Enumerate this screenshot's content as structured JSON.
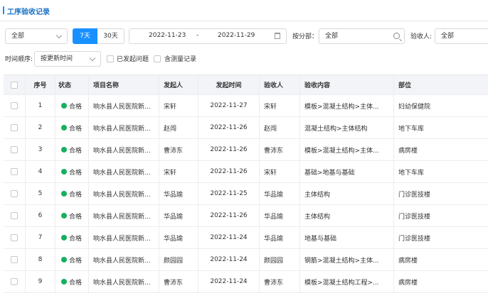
{
  "header": {
    "title": "工序验收记录"
  },
  "filters": {
    "project_select": "全部",
    "range_7d": "7天",
    "range_30d": "30天",
    "date_start": "2022-11-23",
    "date_sep": "-",
    "date_end": "2022-11-29",
    "partition_label": "按分部：",
    "partition_value": "全部",
    "acceptor_label": "验收人:",
    "acceptor_value": "全部",
    "time_order_label": "时间顺序:",
    "time_order_value": "按更新时间",
    "issue_label": "已发起问题",
    "measure_label": "含测量记录"
  },
  "table": {
    "columns": [
      "序号",
      "状态",
      "项目名称",
      "发起人",
      "发起时间",
      "验收人",
      "验收内容",
      "部位"
    ],
    "rows": [
      {
        "no": "1",
        "status": "合格",
        "project": "响水县人民医院新...",
        "initiator": "宋轩",
        "time": "2022-11-27",
        "acceptor": "宋轩",
        "content": "模板>混凝土结构>主体...",
        "location": "妇幼保健院"
      },
      {
        "no": "2",
        "status": "合格",
        "project": "响水县人民医院新...",
        "initiator": "赵闯",
        "time": "2022-11-26",
        "acceptor": "赵闯",
        "content": "混凝土结构>主体结构",
        "location": "地下车库"
      },
      {
        "no": "3",
        "status": "合格",
        "project": "响水县人民医院新...",
        "initiator": "曹沛东",
        "time": "2022-11-26",
        "acceptor": "曹沛东",
        "content": "模板>混凝土结构>主体...",
        "location": "病房楼"
      },
      {
        "no": "4",
        "status": "合格",
        "project": "响水县人民医院新...",
        "initiator": "宋轩",
        "time": "2022-11-26",
        "acceptor": "宋轩",
        "content": "基础>地基与基础",
        "location": "地下车库"
      },
      {
        "no": "5",
        "status": "合格",
        "project": "响水县人民医院新...",
        "initiator": "华品瑜",
        "time": "2022-11-25",
        "acceptor": "华品瑜",
        "content": "主体结构",
        "location": "门诊医技楼"
      },
      {
        "no": "6",
        "status": "合格",
        "project": "响水县人民医院新...",
        "initiator": "华品瑜",
        "time": "2022-11-26",
        "acceptor": "华品瑜",
        "content": "主体结构",
        "location": "门诊医技楼"
      },
      {
        "no": "7",
        "status": "合格",
        "project": "响水县人民医院新...",
        "initiator": "华品瑜",
        "time": "2022-11-24",
        "acceptor": "华品瑜",
        "content": "地基与基础",
        "location": "门诊医技楼"
      },
      {
        "no": "8",
        "status": "合格",
        "project": "响水县人民医院新...",
        "initiator": "颜园园",
        "time": "2022-11-24",
        "acceptor": "颜园园",
        "content": "钢筋>混凝土结构>主体...",
        "location": "病房楼"
      },
      {
        "no": "9",
        "status": "合格",
        "project": "响水县人民医院新...",
        "initiator": "曹沛东",
        "time": "2022-11-24",
        "acceptor": "曹沛东",
        "content": "模板>混凝土结构工程>...",
        "location": "病房楼"
      }
    ]
  },
  "colors": {
    "accent": "#1890ff",
    "pass": "#16b05c"
  }
}
